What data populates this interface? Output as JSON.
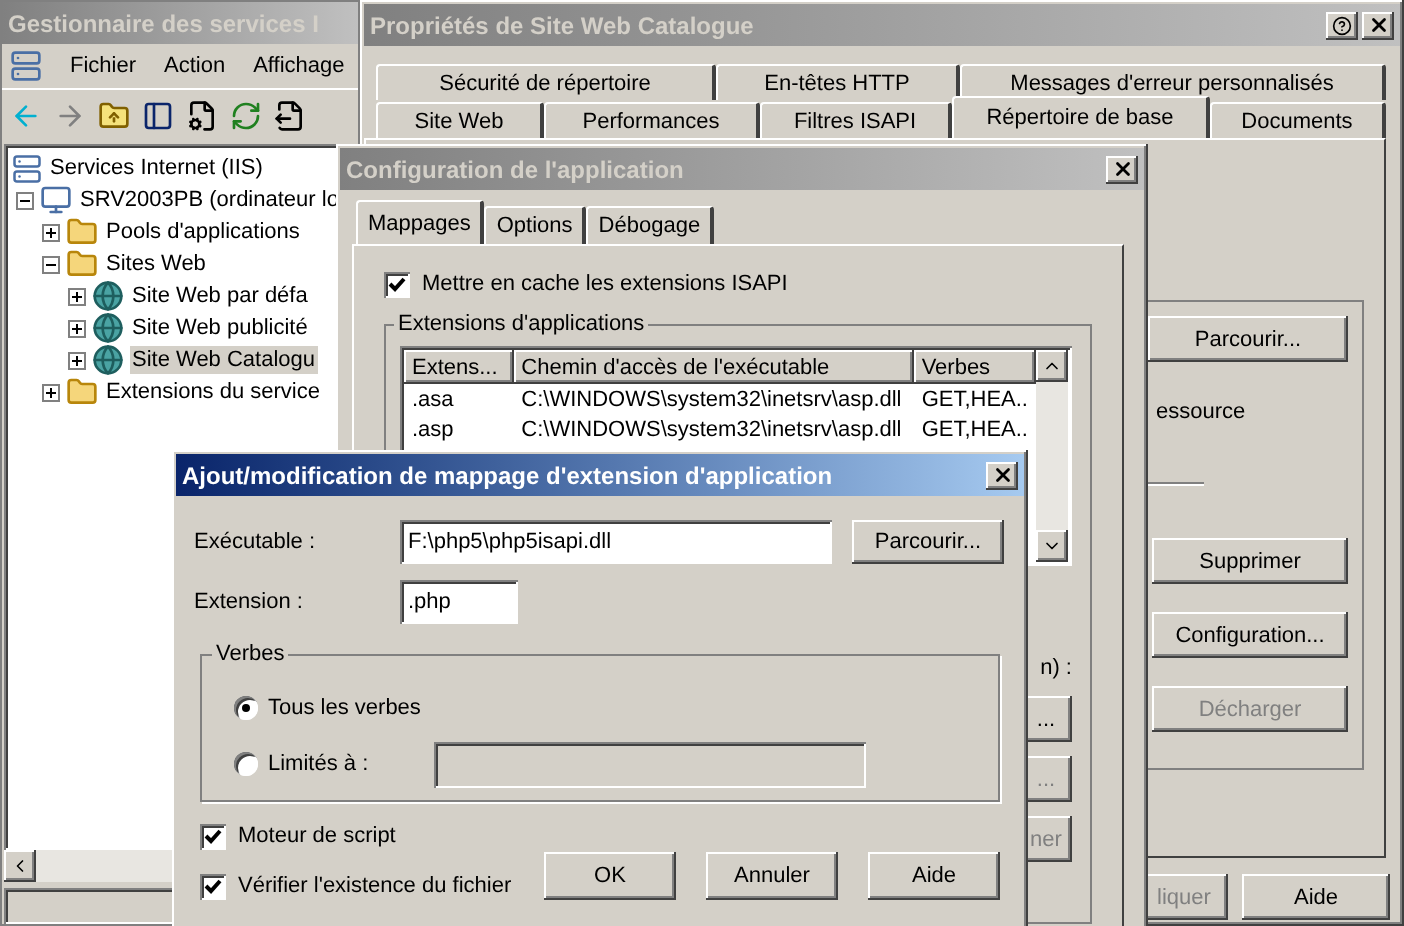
{
  "mmc": {
    "title": "Gestionnaire des services I",
    "active": false,
    "menu": [
      {
        "label": "Fichier"
      },
      {
        "label": "Action"
      },
      {
        "label": "Affichage"
      }
    ],
    "tree": [
      {
        "label": "Services Internet (IIS)",
        "kind": "root",
        "selected": false,
        "children": [
          {
            "label": "SRV2003PB (ordinateur lo",
            "kind": "server",
            "expanded": true,
            "selected": false,
            "children": [
              {
                "label": "Pools d'applications",
                "kind": "folder",
                "expanded": false,
                "selected": false
              },
              {
                "label": "Sites Web",
                "kind": "folder",
                "expanded": true,
                "selected": false,
                "children": [
                  {
                    "label": "Site Web par défa",
                    "kind": "site",
                    "expanded": false,
                    "selected": false
                  },
                  {
                    "label": "Site Web publicité",
                    "kind": "site",
                    "expanded": false,
                    "selected": false
                  },
                  {
                    "label": "Site Web Catalogu",
                    "kind": "site",
                    "expanded": false,
                    "selected": true
                  }
                ]
              },
              {
                "label": "Extensions du service",
                "kind": "folder",
                "expanded": false,
                "selected": false
              }
            ]
          }
        ]
      }
    ]
  },
  "properties": {
    "title": "Propriétés de Site Web Catalogue",
    "active": false,
    "tab_rows": [
      [
        {
          "label": "Sécurité de répertoire",
          "selected": false
        },
        {
          "label": "En-têtes HTTP",
          "selected": false
        },
        {
          "label": "Messages d'erreur personnalisés",
          "selected": false
        }
      ],
      [
        {
          "label": "Site Web",
          "selected": false
        },
        {
          "label": "Performances",
          "selected": false
        },
        {
          "label": "Filtres ISAPI",
          "selected": false
        },
        {
          "label": "Répertoire de base",
          "selected": true
        },
        {
          "label": "Documents",
          "selected": false
        }
      ]
    ],
    "browse_button": {
      "label": "Parcourir...",
      "disabled": false
    },
    "text_fragment": "essource",
    "buttons": [
      {
        "label": "Supprimer",
        "disabled": false
      },
      {
        "label": "Configuration...",
        "disabled": false
      },
      {
        "label": "Décharger",
        "disabled": true
      }
    ],
    "footer_buttons": [
      {
        "label": "liquer",
        "disabled": true
      },
      {
        "label": "Aide",
        "disabled": false
      }
    ]
  },
  "config": {
    "title": "Configuration de l'application",
    "active": false,
    "tabs": [
      {
        "label": "Mappages",
        "selected": true
      },
      {
        "label": "Options",
        "selected": false
      },
      {
        "label": "Débogage",
        "selected": false
      }
    ],
    "cache_checkbox": {
      "label": "Mettre en cache les extensions ISAPI",
      "checked": true
    },
    "group_title": "Extensions d'applications",
    "columns": [
      "Extens...",
      "Chemin d'accès de l'exécutable",
      "Verbes"
    ],
    "rows": [
      [
        ".asa",
        "C:\\WINDOWS\\system32\\inetsrv\\asp.dll",
        "GET,HEA.."
      ],
      [
        ".asp",
        "C:\\WINDOWS\\system32\\inetsrv\\asp.dll",
        "GET,HEA.."
      ]
    ],
    "text_fragment": "n) :",
    "button_fragments": [
      {
        "label": "...",
        "disabled": false
      },
      {
        "label": "...",
        "disabled": true
      },
      {
        "label": "ner",
        "disabled": true
      }
    ]
  },
  "dialog": {
    "title": "Ajout/modification de mappage d'extension d'application",
    "active": true,
    "executable": {
      "label": "Exécutable :",
      "value": "F:\\php5\\php5isapi.dll"
    },
    "browse_button": "Parcourir...",
    "extension": {
      "label": "Extension :",
      "value": ".php"
    },
    "verbs_group": "Verbes",
    "radios": [
      {
        "label": "Tous les verbes",
        "selected": true
      },
      {
        "label": "Limités à :",
        "selected": false
      }
    ],
    "checkboxes": [
      {
        "label": "Moteur de script",
        "checked": true
      },
      {
        "label": "Vérifier l'existence du fichier",
        "checked": true
      }
    ],
    "buttons": [
      "OK",
      "Annuler",
      "Aide"
    ]
  }
}
